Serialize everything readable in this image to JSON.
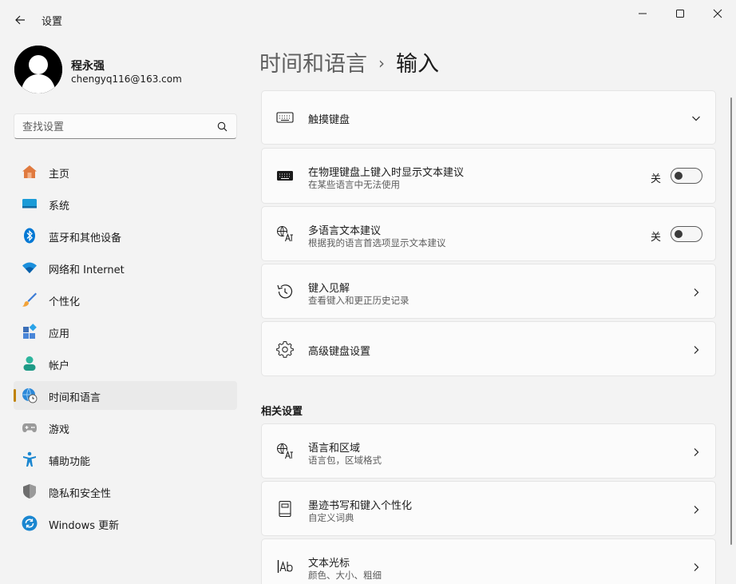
{
  "app": {
    "title": "设置"
  },
  "user": {
    "name": "程永强",
    "email": "chengyq116@163.com"
  },
  "search": {
    "placeholder": "查找设置"
  },
  "sidebar": {
    "items": [
      {
        "label": "主页",
        "icon": "home-icon"
      },
      {
        "label": "系统",
        "icon": "system-icon"
      },
      {
        "label": "蓝牙和其他设备",
        "icon": "bluetooth-icon"
      },
      {
        "label": "网络和 Internet",
        "icon": "wifi-icon"
      },
      {
        "label": "个性化",
        "icon": "brush-icon"
      },
      {
        "label": "应用",
        "icon": "apps-icon"
      },
      {
        "label": "帐户",
        "icon": "account-icon"
      },
      {
        "label": "时间和语言",
        "icon": "time-language-icon",
        "active": true
      },
      {
        "label": "游戏",
        "icon": "gamepad-icon"
      },
      {
        "label": "辅助功能",
        "icon": "accessibility-icon"
      },
      {
        "label": "隐私和安全性",
        "icon": "shield-icon"
      },
      {
        "label": "Windows 更新",
        "icon": "update-icon"
      }
    ]
  },
  "breadcrumb": {
    "parent": "时间和语言",
    "separator": "›",
    "current": "输入"
  },
  "cards": [
    {
      "title": "触摸键盘",
      "icon": "keyboard-outline-icon",
      "control": "chevron-down-icon"
    },
    {
      "title": "在物理键盘上键入时显示文本建议",
      "subtitle": "在某些语言中无法使用",
      "icon": "keyboard-filled-icon",
      "toggle_label": "关",
      "toggle_on": false
    },
    {
      "title": "多语言文本建议",
      "subtitle": "根据我的语言首选项显示文本建议",
      "icon": "language-icon",
      "toggle_label": "关",
      "toggle_on": false
    },
    {
      "title": "键入见解",
      "subtitle": "查看键入和更正历史记录",
      "icon": "history-icon",
      "control": "chevron-right-icon"
    },
    {
      "title": "高级键盘设置",
      "icon": "gear-icon",
      "control": "chevron-right-icon"
    }
  ],
  "related": {
    "title": "相关设置",
    "cards": [
      {
        "title": "语言和区域",
        "subtitle": "语言包，区域格式",
        "icon": "language-icon",
        "control": "chevron-right-icon"
      },
      {
        "title": "墨迹书写和键入个性化",
        "subtitle": "自定义词典",
        "icon": "notebook-icon",
        "control": "chevron-right-icon"
      },
      {
        "title": "文本光标",
        "subtitle": "颜色、大小、粗细",
        "icon": "text-cursor-icon",
        "control": "chevron-right-icon"
      }
    ]
  },
  "colors": {
    "accent": "#c08200",
    "background": "#f3f3f3",
    "card": "#fbfbfb"
  }
}
